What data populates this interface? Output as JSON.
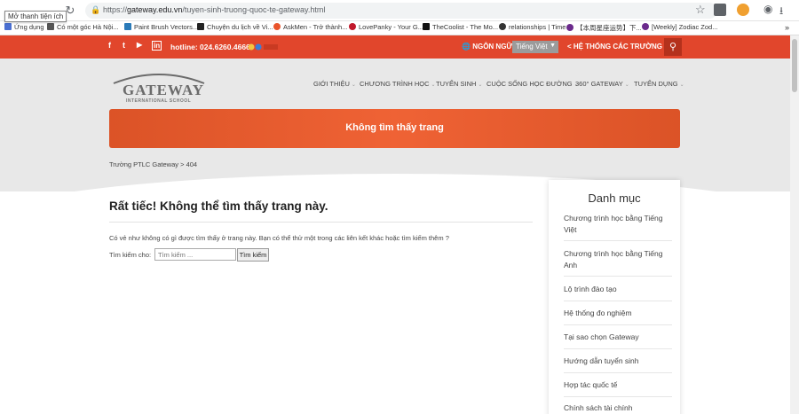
{
  "browser": {
    "tooltip": "Mở thanh tiện ích",
    "url_scheme": "https://",
    "url_host": "gateway.edu.vn",
    "url_path": "/tuyen-sinh-truong-quoc-te-gateway.html",
    "bookmarks": [
      {
        "label": "Ứng dụng",
        "icon": "apps-grid-icon",
        "color": "#4a6fd1"
      },
      {
        "label": "Có một góc Hà Nội...",
        "icon": "people-icon",
        "color": "#555555"
      },
      {
        "label": "Paint Brush Vectors...",
        "icon": "page-icon",
        "color": "#2a7ab8"
      },
      {
        "label": "Chuyện du lịch về Vi...",
        "icon": "k-icon",
        "color": "#222222"
      },
      {
        "label": "AskMen - Trở thành...",
        "icon": "askmen-icon",
        "color": "#e9542b"
      },
      {
        "label": "LovePanky - Your G...",
        "icon": "heart-icon",
        "color": "#c0172a"
      },
      {
        "label": "TheCoolist - The Mo...",
        "icon": "tc-icon",
        "color": "#111111"
      },
      {
        "label": "relationships | Time",
        "icon": "circle-icon",
        "color": "#333333"
      },
      {
        "label": "【本周星座运势】下...",
        "icon": "zodiac-icon",
        "color": "#6b2a8c"
      },
      {
        "label": "[Weekly] Zodiac Zod...",
        "icon": "zodiac-icon",
        "color": "#6b2a8c"
      }
    ]
  },
  "topbar": {
    "social": [
      "f",
      "t",
      "▶",
      "in"
    ],
    "hotline": "hotline: 024.6260.4666",
    "language_label": "NGÔN NGỮ",
    "language_value": "Tiếng Việt",
    "schools_label": "HỆ THỐNG CÁC TRƯỜNG",
    "accent": "#e1462c"
  },
  "logo": {
    "word": "GATEWAY",
    "sub": "INTERNATIONAL SCHOOL"
  },
  "menu": [
    "GIỚI THIỆU",
    "CHƯƠNG TRÌNH HỌC",
    "TUYỂN SINH",
    "CUỘC SỐNG HỌC ĐƯỜNG",
    "360° GATEWAY",
    "TUYỂN DỤNG"
  ],
  "banner": {
    "title": "Không tìm thấy trang"
  },
  "breadcrumb": "Trường PTLC Gateway > 404",
  "main": {
    "title": "Rất tiếc! Không thể tìm thấy trang này.",
    "description": "Có vẻ như không có gì được tìm thấy ở trang này. Bạn có thể thử một trong các liên kết khác hoặc tìm kiếm thêm ?",
    "search_label": "Tìm kiếm cho:",
    "search_placeholder": "Tìm kiếm ...",
    "search_button": "Tìm kiếm"
  },
  "sidebar": {
    "title": "Danh mục",
    "items": [
      "Chương trình học bằng Tiếng Việt",
      "Chương trình học bằng Tiếng Anh",
      "Lộ trình đào tạo",
      "Hệ thống đo nghiệm",
      "Tại sao chọn Gateway",
      "Hướng dẫn tuyển sinh",
      "Hợp tác quốc tế",
      "Chính sách tài chính"
    ]
  }
}
